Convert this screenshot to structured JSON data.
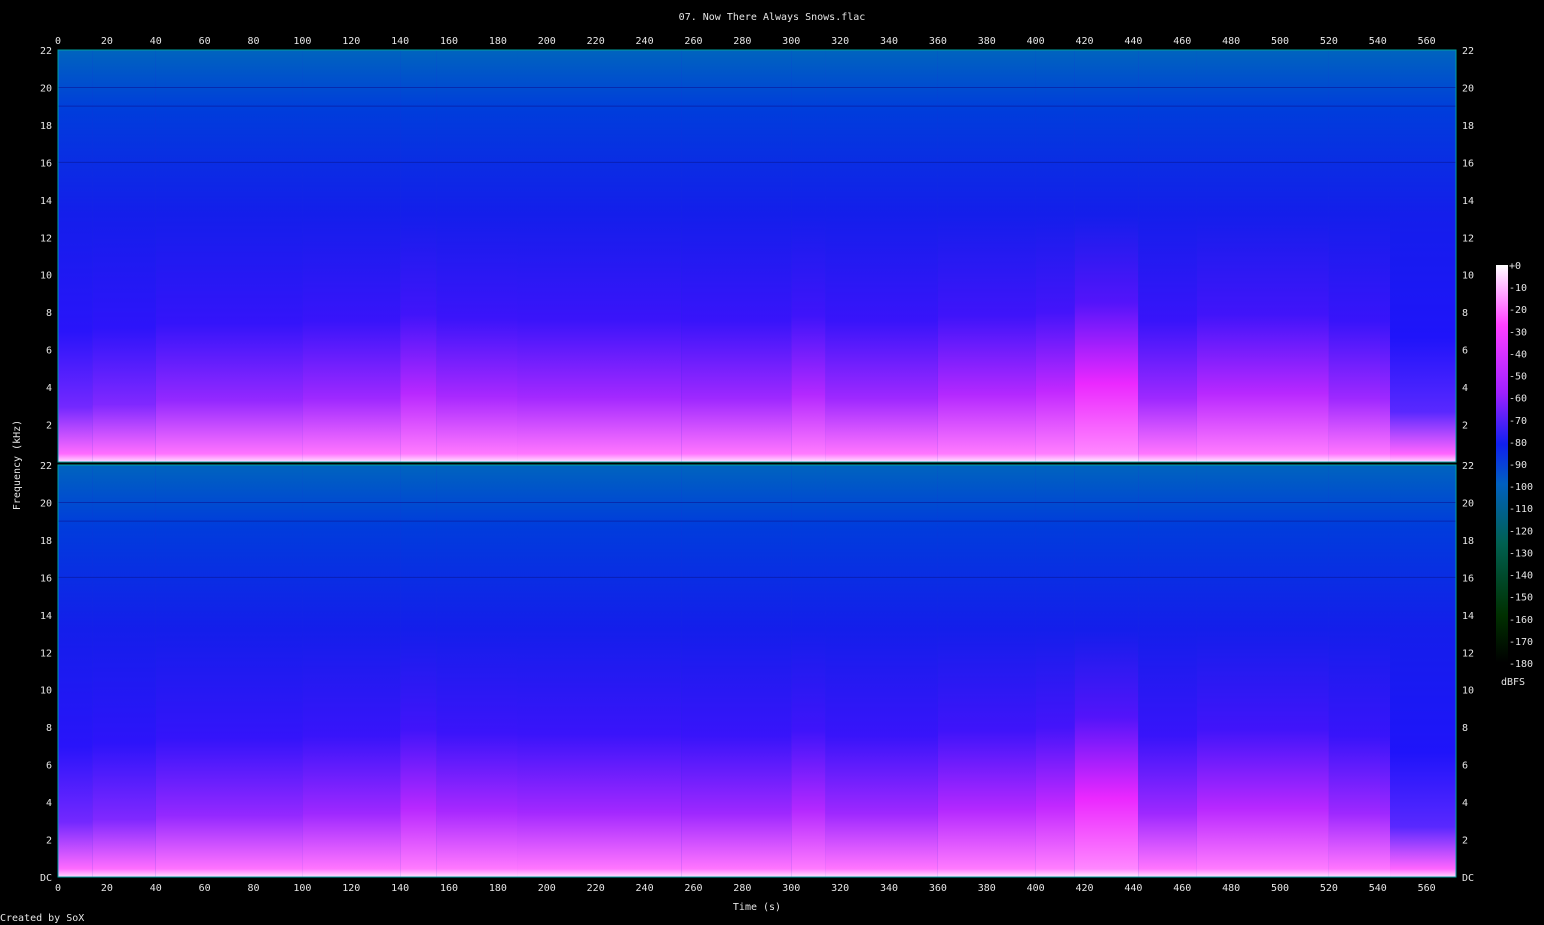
{
  "chart_data": {
    "type": "heatmap",
    "title": "07. Now There Always Snows.flac",
    "xlabel": "Time (s)",
    "ylabel": "Frequency (kHz)",
    "footer": "Created by SoX",
    "colorbar_label": "dBFS",
    "xlim": [
      0,
      572
    ],
    "ylim": [
      0,
      22
    ],
    "x_ticks": [
      "0",
      "20",
      "40",
      "60",
      "80",
      "100",
      "120",
      "140",
      "160",
      "180",
      "200",
      "220",
      "240",
      "260",
      "280",
      "300",
      "320",
      "340",
      "360",
      "380",
      "400",
      "420",
      "440",
      "460",
      "480",
      "500",
      "520",
      "540",
      "560"
    ],
    "y_ticks": [
      "DC",
      "2",
      "4",
      "6",
      "8",
      "10",
      "12",
      "14",
      "16",
      "18",
      "20",
      "22"
    ],
    "colorbar_ticks": [
      "+0",
      "-10",
      "-20",
      "-30",
      "-40",
      "-50",
      "-60",
      "-70",
      "-80",
      "-90",
      "-100",
      "-110",
      "-120",
      "-130",
      "-140",
      "-150",
      "-160",
      "-170",
      "-180"
    ],
    "channels": 2,
    "segments": [
      {
        "start": 0,
        "end": 14,
        "energy": 0.45
      },
      {
        "start": 14,
        "end": 40,
        "energy": 0.5
      },
      {
        "start": 40,
        "end": 100,
        "energy": 0.58
      },
      {
        "start": 100,
        "end": 140,
        "energy": 0.62
      },
      {
        "start": 140,
        "end": 155,
        "energy": 0.72
      },
      {
        "start": 155,
        "end": 188,
        "energy": 0.66
      },
      {
        "start": 188,
        "end": 255,
        "energy": 0.64
      },
      {
        "start": 255,
        "end": 300,
        "energy": 0.62
      },
      {
        "start": 300,
        "end": 314,
        "energy": 0.7
      },
      {
        "start": 314,
        "end": 360,
        "energy": 0.62
      },
      {
        "start": 360,
        "end": 400,
        "energy": 0.7
      },
      {
        "start": 400,
        "end": 416,
        "energy": 0.76
      },
      {
        "start": 416,
        "end": 442,
        "energy": 0.92
      },
      {
        "start": 442,
        "end": 466,
        "energy": 0.62
      },
      {
        "start": 466,
        "end": 520,
        "energy": 0.72
      },
      {
        "start": 520,
        "end": 545,
        "energy": 0.62
      },
      {
        "start": 545,
        "end": 572,
        "energy": 0.35
      }
    ]
  }
}
